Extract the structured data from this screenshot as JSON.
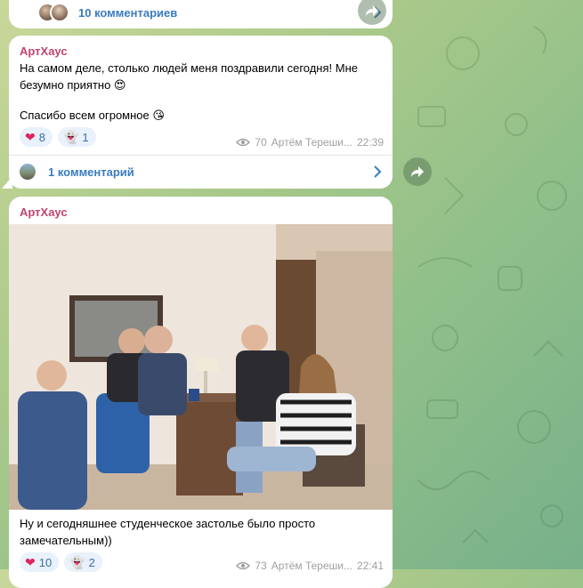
{
  "top_message": {
    "comments_label": "10 комментариев"
  },
  "message_1": {
    "sender": "АртХаус",
    "text_line_1": "На самом деле, столько людей меня поздравили сегодня! Мне безумно приятно 😍",
    "text_line_2": "Спасибо всем огромное 😘",
    "reactions": [
      {
        "emoji": "❤",
        "icon": "heart-icon",
        "count": "8"
      },
      {
        "emoji": "👻",
        "icon": "ghost-icon",
        "count": "1"
      }
    ],
    "views": "70",
    "author": "Артём Тереши...",
    "time": "22:39",
    "comments_label": "1 комментарий"
  },
  "message_2": {
    "sender": "АртХаус",
    "photo_icon": "photo-of-group-at-table",
    "text": "Ну и сегодняшнее студенческое застолье было просто замечательным))",
    "reactions": [
      {
        "emoji": "❤",
        "icon": "heart-icon",
        "count": "10"
      },
      {
        "emoji": "👻",
        "icon": "ghost-icon",
        "count": "2"
      }
    ],
    "views": "73",
    "author": "Артём Тереши...",
    "time": "22:41"
  },
  "colors": {
    "sender": "#c2446f",
    "link": "#3a7bbf",
    "reaction_bg": "#e9f1fb",
    "heart": "#e0245e"
  }
}
